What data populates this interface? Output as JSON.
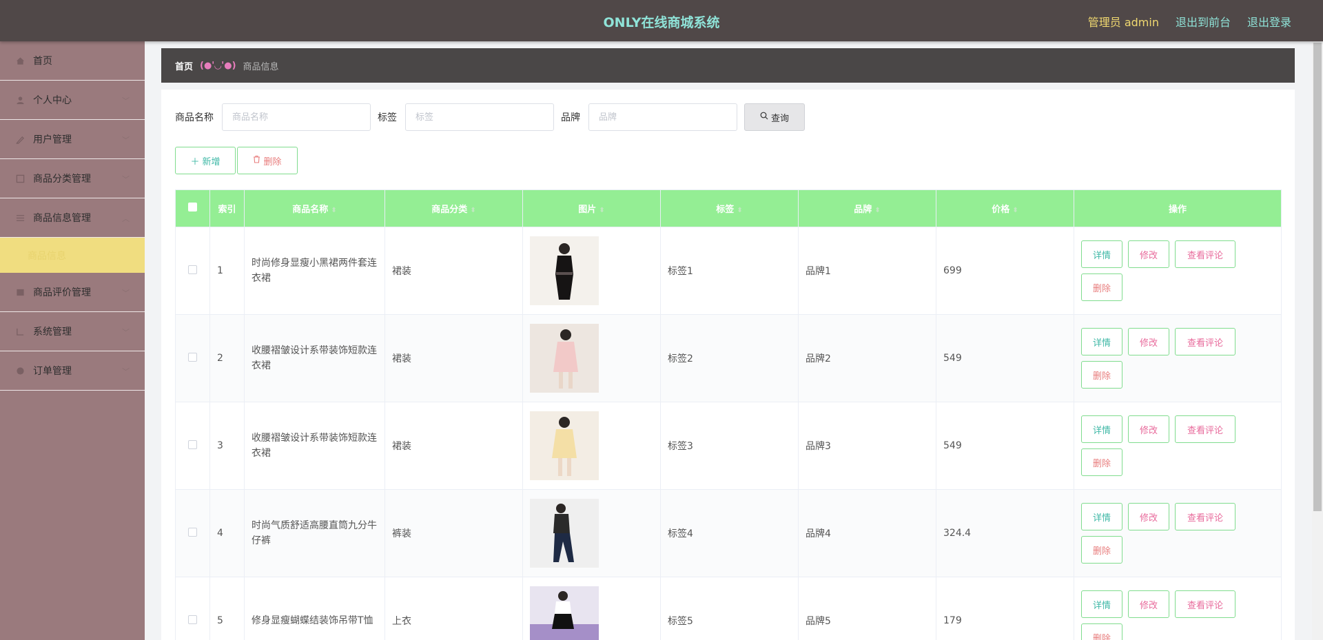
{
  "header": {
    "title": "ONLY在线商城系统",
    "admin_label": "管理员 admin",
    "to_front": "退出到前台",
    "logout": "退出登录"
  },
  "sidebar": {
    "items": [
      {
        "label": "首页",
        "icon": "home-icon"
      },
      {
        "label": "个人中心",
        "icon": "user-icon"
      },
      {
        "label": "用户管理",
        "icon": "users-icon"
      },
      {
        "label": "商品分类管理",
        "icon": "category-icon"
      },
      {
        "label": "商品信息管理",
        "icon": "list-icon"
      },
      {
        "label": "商品信息",
        "icon": ""
      },
      {
        "label": "商品评价管理",
        "icon": "comment-icon"
      },
      {
        "label": "系统管理",
        "icon": "settings-icon"
      },
      {
        "label": "订单管理",
        "icon": "order-icon"
      }
    ]
  },
  "breadcrumb": {
    "home": "首页",
    "separator": "(●'◡'●)",
    "current": "商品信息"
  },
  "search": {
    "name_label": "商品名称",
    "name_placeholder": "商品名称",
    "tag_label": "标签",
    "tag_placeholder": "标签",
    "brand_label": "品牌",
    "brand_placeholder": "品牌",
    "query_button": "查询"
  },
  "actions": {
    "add": "新增",
    "delete": "删除"
  },
  "table": {
    "columns": [
      "索引",
      "商品名称",
      "商品分类",
      "图片",
      "标签",
      "品牌",
      "价格",
      "操作"
    ],
    "ops": {
      "detail": "详情",
      "edit": "修改",
      "review": "查看评论",
      "delete": "删除"
    },
    "rows": [
      {
        "index": "1",
        "name": "时尚修身显瘦小黑裙两件套连衣裙",
        "category": "裙装",
        "tag": "标签1",
        "brand": "品牌1",
        "price": "699"
      },
      {
        "index": "2",
        "name": "收腰褶皱设计系带装饰短款连衣裙",
        "category": "裙装",
        "tag": "标签2",
        "brand": "品牌2",
        "price": "549"
      },
      {
        "index": "3",
        "name": "收腰褶皱设计系带装饰短款连衣裙",
        "category": "裙装",
        "tag": "标签3",
        "brand": "品牌3",
        "price": "549"
      },
      {
        "index": "4",
        "name": "时尚气质舒适高腰直筒九分牛仔裤",
        "category": "裤装",
        "tag": "标签4",
        "brand": "品牌4",
        "price": "324.4"
      },
      {
        "index": "5",
        "name": "修身显瘦蝴蝶结装饰吊带T恤",
        "category": "上衣",
        "tag": "标签5",
        "brand": "品牌5",
        "price": "179"
      }
    ]
  },
  "colors": {
    "header_bg": "#504848",
    "title": "#8fe3d8",
    "sidebar_bg": "#9a7a7d",
    "active_sub": "#f0dd80",
    "table_head": "#94ee94",
    "button_border": "#7fdc8d"
  }
}
